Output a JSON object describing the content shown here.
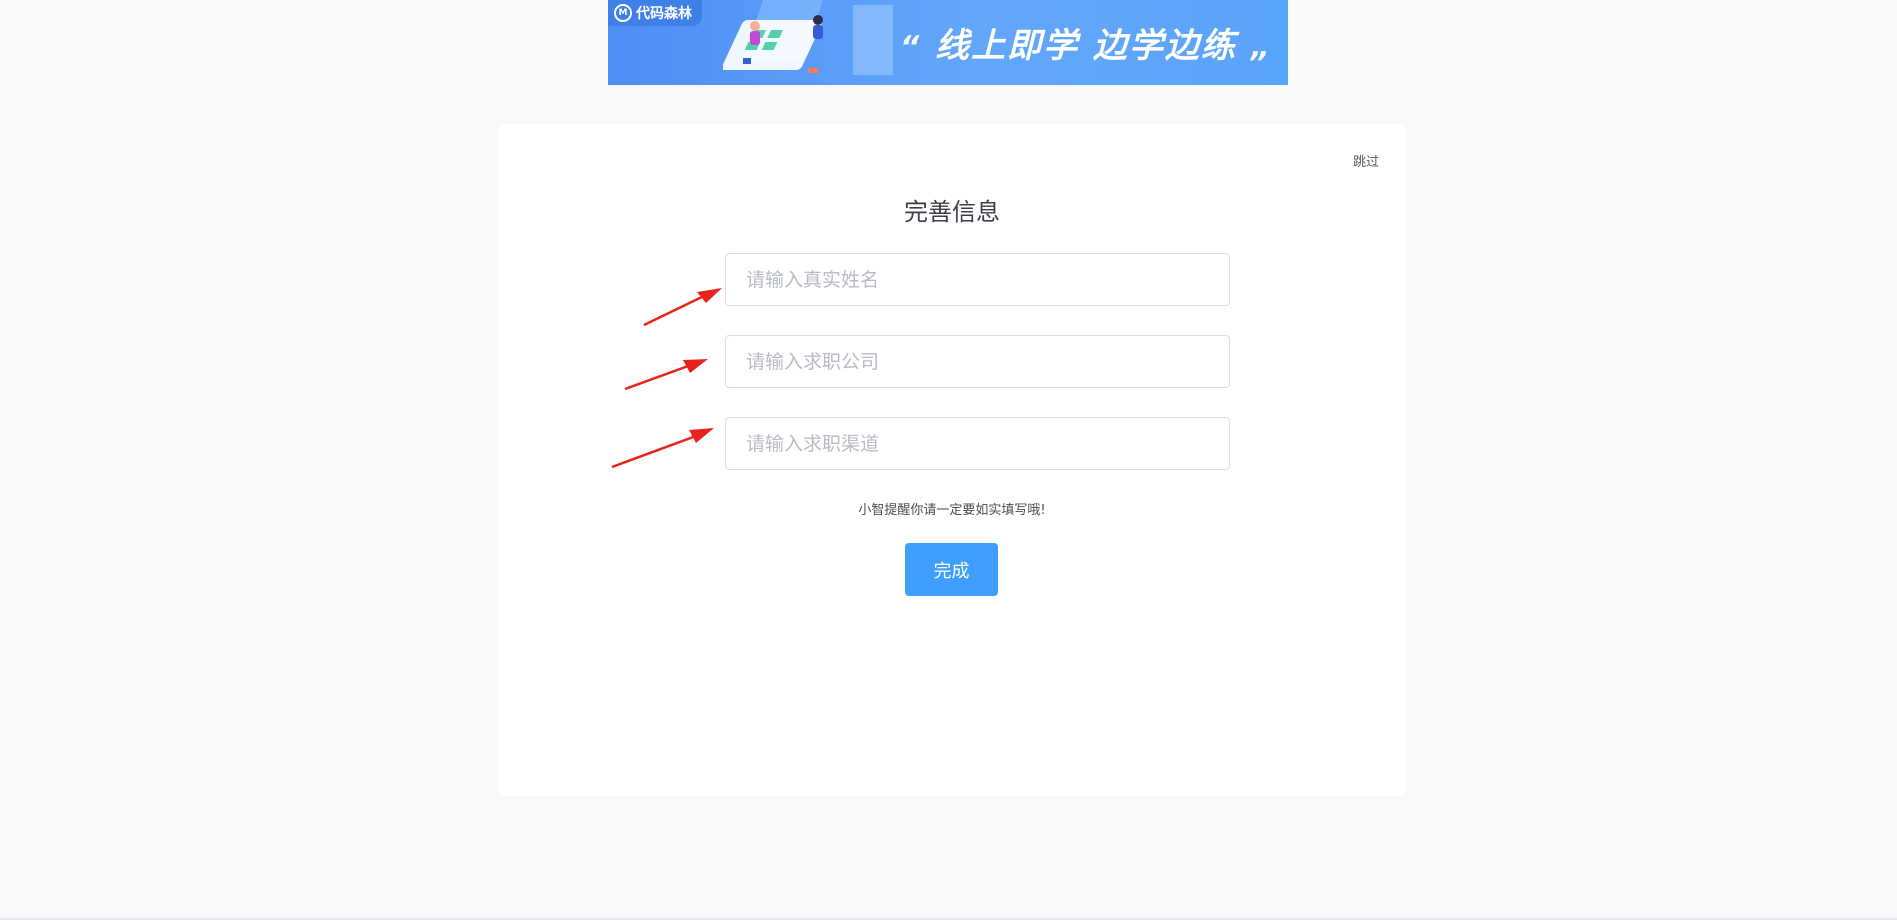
{
  "banner": {
    "logo_text": "代码森林",
    "slogan": "线上即学 边学边练",
    "quote_open": "“",
    "quote_close": "„"
  },
  "card": {
    "skip_label": "跳过",
    "title": "完善信息",
    "fields": {
      "name_placeholder": "请输入真实姓名",
      "company_placeholder": "请输入求职公司",
      "channel_placeholder": "请输入求职渠道"
    },
    "hint": "小智提醒你请一定要如实填写哦!",
    "submit_label": "完成"
  },
  "colors": {
    "accent": "#409eff",
    "annotation_arrow": "#e8231c",
    "banner_blue": "#4d8ff5",
    "background": "#f8f9fb"
  }
}
